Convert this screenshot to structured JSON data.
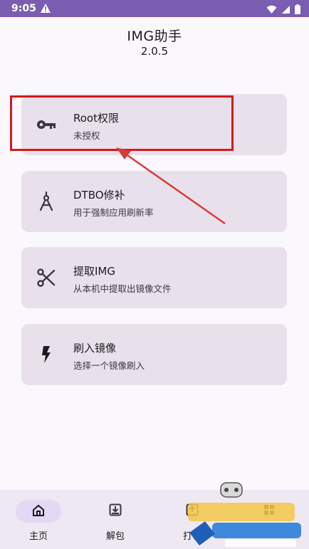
{
  "status_bar": {
    "time": "9:05"
  },
  "header": {
    "title": "IMG助手",
    "version": "2.0.5"
  },
  "cards": [
    {
      "title": "Root权限",
      "subtitle": "未授权",
      "icon": "key-icon"
    },
    {
      "title": "DTBO修补",
      "subtitle": "用于强制应用刷新率",
      "icon": "compass-icon"
    },
    {
      "title": "提取IMG",
      "subtitle": "从本机中提取出镜像文件",
      "icon": "scissors-icon"
    },
    {
      "title": "刷入镜像",
      "subtitle": "选择一个镜像刷入",
      "icon": "flash-icon"
    }
  ],
  "nav": [
    {
      "label": "主页",
      "icon": "home-icon",
      "active": true
    },
    {
      "label": "解包",
      "icon": "unpack-icon",
      "active": false
    },
    {
      "label": "打包",
      "icon": "pack-icon",
      "active": false
    },
    {
      "label": "",
      "icon": "more-icon",
      "active": false
    }
  ],
  "annotation": {
    "highlight_color": "#d21a1a"
  },
  "colors": {
    "status_bar": "#7a5db0",
    "card": "#e8e1ec",
    "nav_bg": "#eee8f2",
    "nav_active": "#e4d8f5"
  }
}
